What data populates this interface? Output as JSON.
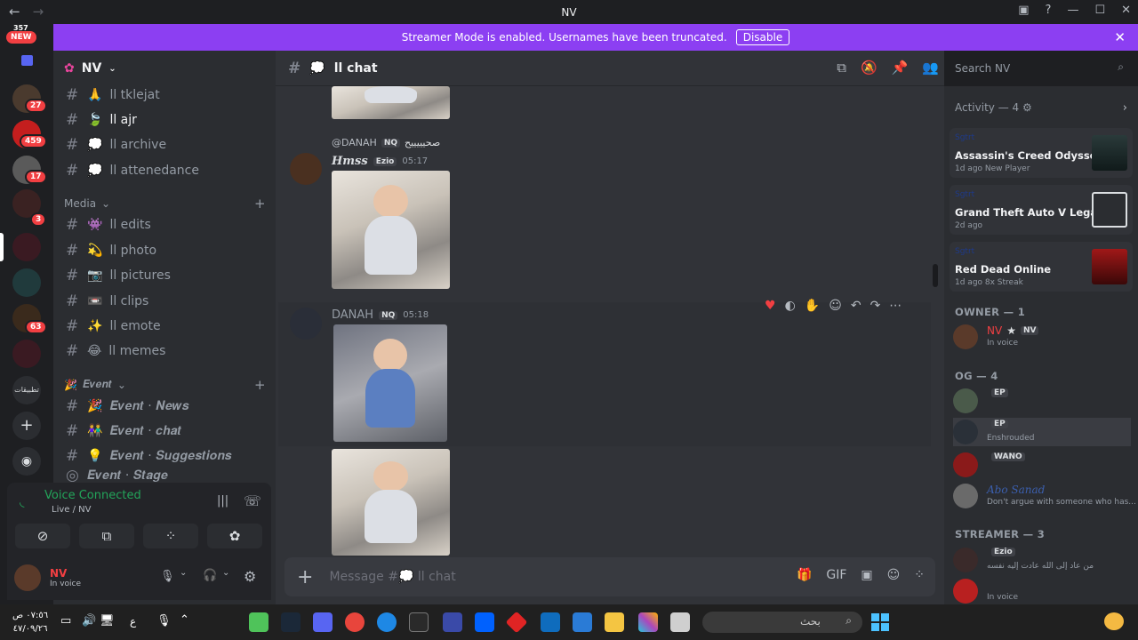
{
  "window": {
    "title": "NV",
    "back": "←",
    "forward": "→"
  },
  "streamer": {
    "message": "Streamer Mode is enabled. Usernames have been truncated.",
    "button": "Disable",
    "close": "✕"
  },
  "rail": {
    "new_count": "357",
    "new_label": "NEW",
    "badges": [
      "27",
      "459",
      "17",
      "3",
      "63"
    ],
    "bottom_label": "تطبيقات"
  },
  "server": {
    "name": "NV"
  },
  "channels": [
    {
      "label": "tklejat",
      "emoji": "🙏",
      "active": false
    },
    {
      "label": "ajr",
      "emoji": "🍃",
      "active": true
    },
    {
      "label": "archive",
      "emoji": "💭",
      "active": false
    },
    {
      "label": "attenedance",
      "emoji": "💭",
      "active": false
    }
  ],
  "media_category": "Media",
  "media_channels": [
    {
      "label": "edits",
      "emoji": "👾"
    },
    {
      "label": "photo",
      "emoji": "💫"
    },
    {
      "label": "pictures",
      "emoji": "📷"
    },
    {
      "label": "clips",
      "emoji": "📼"
    },
    {
      "label": "emote",
      "emoji": "✨"
    },
    {
      "label": "memes",
      "emoji": "😂"
    }
  ],
  "event_category": "𝑬𝒗𝒆𝒏𝒕",
  "event_channels": [
    {
      "label": "𝑬𝒗𝒆𝒏𝒕 · 𝑵𝒆𝒘𝒔",
      "emoji": "🎉"
    },
    {
      "label": "𝑬𝒗𝒆𝒏𝒕 · 𝒄𝒉𝒂𝒕",
      "emoji": "👫"
    },
    {
      "label": "𝑬𝒗𝒆𝒏𝒕 · 𝑺𝒖𝒈𝒈𝒆𝒔𝒕𝒊𝒐𝒏𝒔",
      "emoji": "💡"
    },
    {
      "label": "𝑬𝒗𝒆𝒏𝒕 · 𝑺𝒕𝒂𝒈𝒆",
      "emoji": "◎"
    }
  ],
  "voice": {
    "title": "Voice Connected",
    "subtitle": "Live / NV"
  },
  "user": {
    "name": "NV",
    "status": "In voice"
  },
  "chat": {
    "channel": "ll chat",
    "composer_placeholder": "Message #💭 ll chat"
  },
  "search": {
    "placeholder": "Search NV"
  },
  "messages": [
    {
      "reply_to": "@DANAH",
      "reply_tag": "NQ",
      "reply_text": "صحيييييح",
      "author": "Hmss",
      "author_tag": "Ezio",
      "time": "05:17"
    },
    {
      "author": "DANAH",
      "author_tag": "NQ",
      "time": "05:18"
    }
  ],
  "activity": {
    "title": "Activity — 4",
    "cards": [
      {
        "user": "Sgtrt",
        "game": "Assassin's Creed Odyssey",
        "meta": "1d ago  New Player"
      },
      {
        "user": "Sgtrt",
        "game": "Grand Theft Auto V Legacy",
        "meta": "2d ago"
      },
      {
        "user": "Sgtrt",
        "game": "Red Dead Online",
        "meta": "1d ago  8x Streak"
      }
    ]
  },
  "groups": [
    {
      "title": "OWNER — 1"
    },
    {
      "title": "OG — 4"
    },
    {
      "title": "STREAMER — 3"
    }
  ],
  "members": [
    {
      "name": "NV",
      "tag": "NV",
      "status": "In voice"
    },
    {
      "name": "",
      "tag": "EP",
      "status": ""
    },
    {
      "name": "",
      "tag": "EP",
      "status": "Enshrouded"
    },
    {
      "name": "",
      "tag": "WANO",
      "status": ""
    },
    {
      "name": "Abo Sanad",
      "tag": "",
      "status": "Don't argue with someone who has..."
    },
    {
      "name": "",
      "tag": "Ezio",
      "status": "من عاد إلى الله عادت إليه نفسه"
    },
    {
      "name": "",
      "tag": "",
      "status": "In voice"
    }
  ],
  "taskbar": {
    "time": "٠٧:٥٦ ص",
    "date": "٤٧/٠٩/٢٦",
    "search": "بحث",
    "lang": "ع"
  },
  "colors": {
    "accent": "#8c3ff2",
    "online": "#23a55a",
    "badge": "#f23f42"
  }
}
